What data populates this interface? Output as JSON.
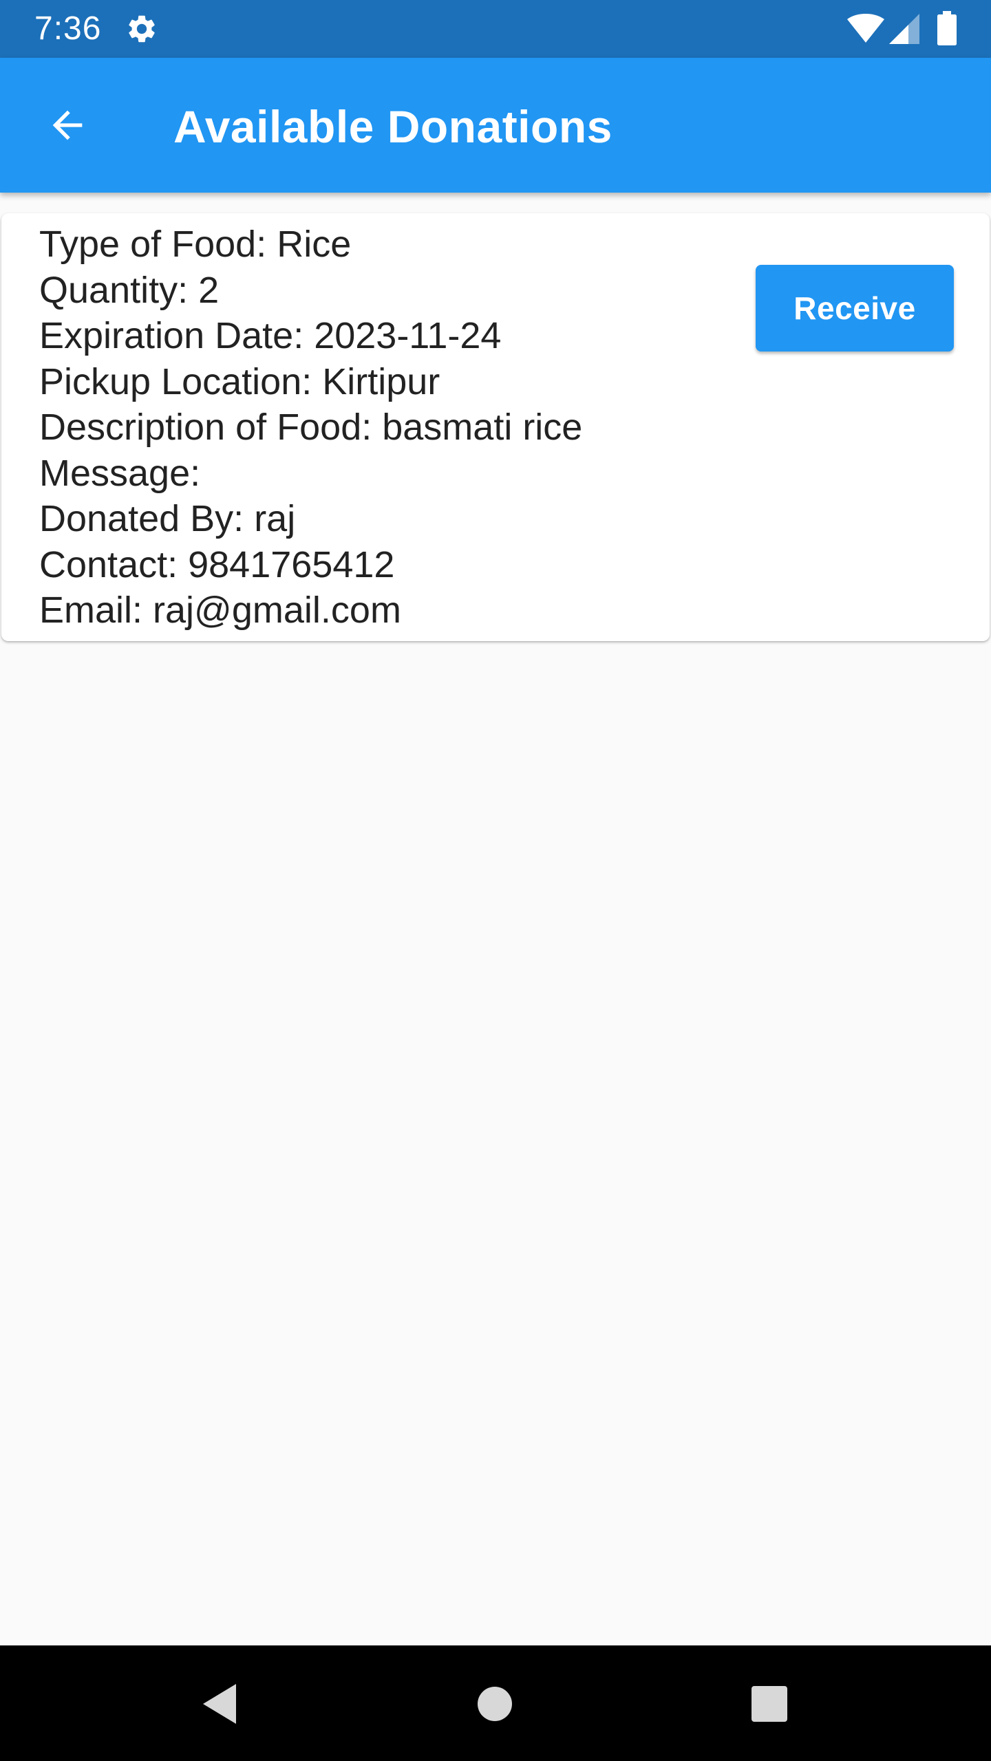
{
  "status_bar": {
    "time": "7:36",
    "icons": [
      "gear-icon",
      "wifi-icon",
      "signal-icon",
      "battery-icon"
    ],
    "background_color": "#1c70b9"
  },
  "app_bar": {
    "title": "Available Donations",
    "back_icon": "arrow-back-icon",
    "background_color": "#2196f3"
  },
  "donation": {
    "type_of_food": "Type of Food: Rice",
    "quantity": "Quantity: 2",
    "expiration_date": "Expiration Date: 2023-11-24",
    "pickup_location": "Pickup Location: Kirtipur",
    "description": "Description of Food: basmati rice",
    "message": "Message:",
    "donated_by": "Donated By: raj",
    "contact": "Contact: 9841765412",
    "email": "Email: raj@gmail.com",
    "receive_label": "Receive",
    "button_color": "#2196f3"
  },
  "nav_bar": {
    "icons": [
      "nav-back-icon",
      "nav-home-icon",
      "nav-recents-icon"
    ],
    "background_color": "#000000"
  }
}
